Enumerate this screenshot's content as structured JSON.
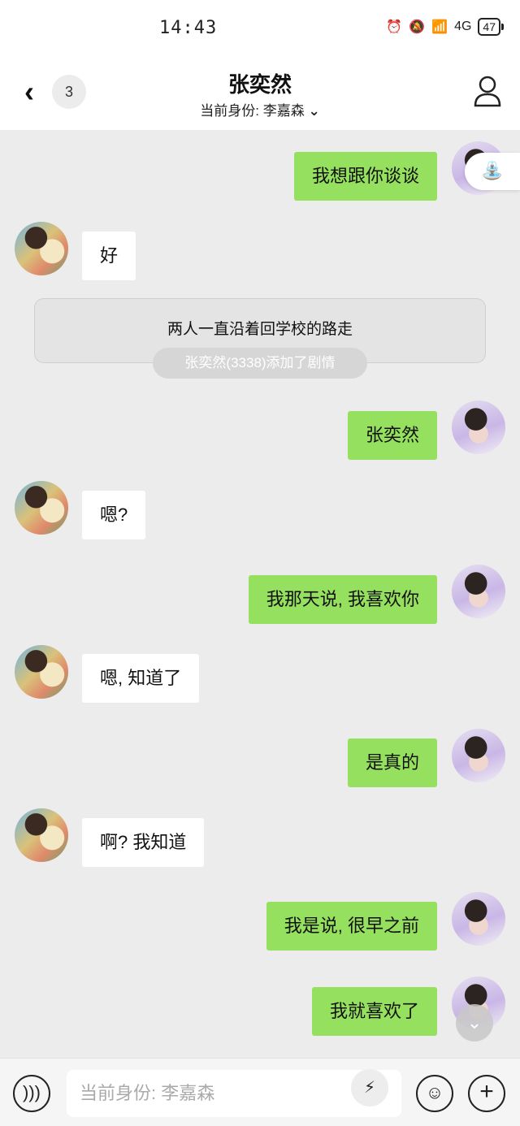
{
  "status": {
    "time": "14:43",
    "signal": "4G",
    "battery": "47"
  },
  "header": {
    "back_count": "3",
    "title": "张奕然",
    "identity": "当前身份: 李嘉森"
  },
  "narration": {
    "text": "两人一直沿着回学校的路走",
    "tag": "张奕然(3338)添加了剧情"
  },
  "messages": [
    {
      "text": "我想跟你谈谈"
    },
    {
      "text": "好"
    },
    {
      "text": "张奕然"
    },
    {
      "text": "嗯?"
    },
    {
      "text": "我那天说, 我喜欢你"
    },
    {
      "text": "嗯, 知道了"
    },
    {
      "text": "是真的"
    },
    {
      "text": "啊? 我知道"
    },
    {
      "text": "我是说, 很早之前"
    },
    {
      "text": "我就喜欢了"
    }
  ],
  "input": {
    "placeholder": "当前身份: 李嘉森"
  },
  "icons": {
    "back": "chevron-left-icon",
    "profile": "person-icon",
    "voice": "voice-icon",
    "bulb": "lightning-bulb-icon",
    "emoji": "emoji-icon",
    "add": "plus-icon",
    "scroll": "chevron-down-icon"
  },
  "colors": {
    "outgoing": "#95e05e",
    "incoming": "#ffffff",
    "background": "#ececec"
  }
}
